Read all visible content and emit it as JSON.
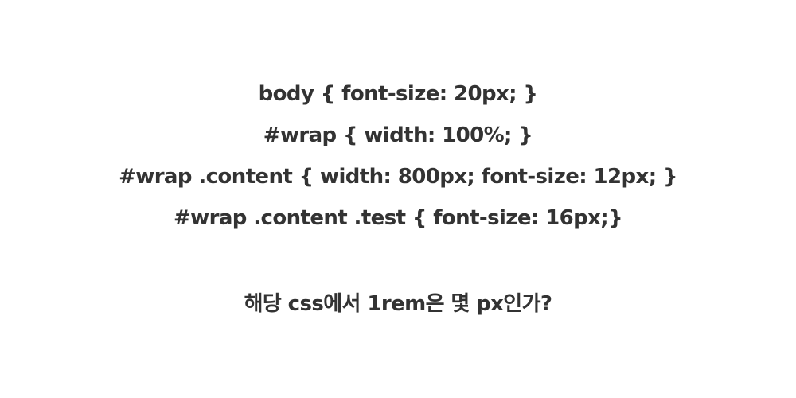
{
  "code_lines": [
    "body { font-size: 20px; }",
    "#wrap { width: 100%; }",
    "#wrap .content { width: 800px; font-size: 12px; }",
    "#wrap .content .test { font-size: 16px;}"
  ],
  "question": "해당 css에서 1rem은 몇 px인가?",
  "colors": {
    "text": "#333333",
    "background": "#ffffff"
  }
}
